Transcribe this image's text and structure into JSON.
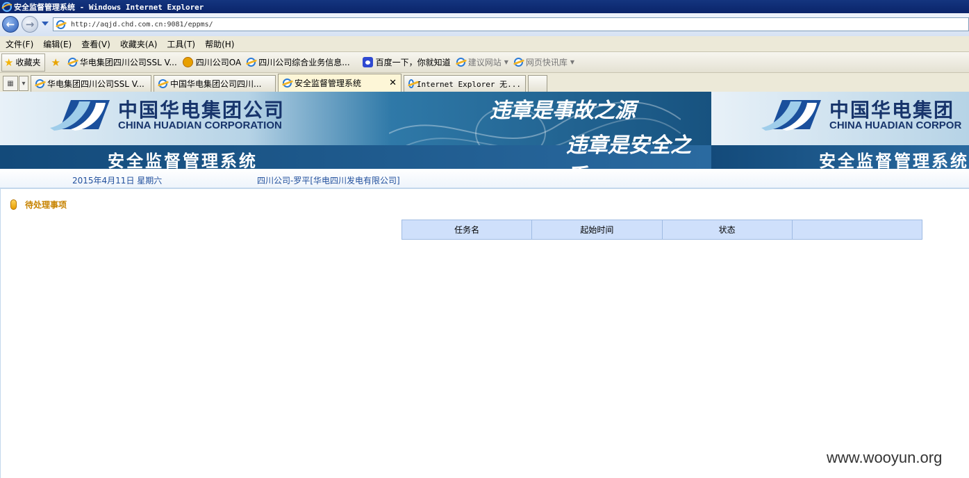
{
  "window": {
    "title": "安全监督管理系统 - Windows Internet Explorer"
  },
  "navigation": {
    "back_glyph": "←",
    "forward_glyph": "→",
    "url": "http://aqjd.chd.com.cn:9081/eppms/"
  },
  "menu": [
    "文件(F)",
    "编辑(E)",
    "查看(V)",
    "收藏夹(A)",
    "工具(T)",
    "帮助(H)"
  ],
  "favorites_bar": {
    "button_label": "收藏夹",
    "items": [
      {
        "label": "华电集团四川公司SSL V...",
        "icon": "ie-page-icon"
      },
      {
        "label": "四川公司OA",
        "icon": "oa-icon"
      },
      {
        "label": "四川公司综合业务信息...",
        "icon": "ie-page-icon"
      },
      {
        "label": "百度一下，你就知道",
        "icon": "baidu-paw-icon"
      },
      {
        "label": "建议网站",
        "icon": "ie-page-icon",
        "dropdown": true
      },
      {
        "label": "网页快讯库",
        "icon": "ie-page-icon",
        "dropdown": true
      }
    ]
  },
  "tabs": [
    {
      "label": "华电集团四川公司SSL V...",
      "active": false
    },
    {
      "label": "中国华电集团公司四川...",
      "active": false
    },
    {
      "label": "安全监督管理系统",
      "active": true
    },
    {
      "label": "Internet Explorer 无...",
      "active": false
    }
  ],
  "banner": {
    "company_cn": "中国华电集团公司",
    "company_en": "CHINA HUADIAN CORPORATION",
    "system_title": "安全监督管理系统",
    "slogan_line1": "违章是事故之源",
    "slogan_line2": "违章是安全之夭",
    "repeat_company_cn": "中国华电集团",
    "repeat_company_en": "CHINA HUADIAN CORPOR",
    "repeat_system_title": "安全监督管理系统"
  },
  "info": {
    "date": "2015年4月11日 星期六",
    "organization": "四川公司-罗平[华电四川发电有限公司]"
  },
  "pending": {
    "section_label": "待处理事项",
    "columns": [
      "任务名",
      "起始时间",
      "状态",
      ""
    ],
    "rows": []
  },
  "watermark": "www.wooyun.org",
  "colors": {
    "title_bar": "#0a246a",
    "brand_navy": "#17346b",
    "banner_blue": "#17527f",
    "table_header": "#cfe0fb",
    "section_label": "#c78300"
  }
}
